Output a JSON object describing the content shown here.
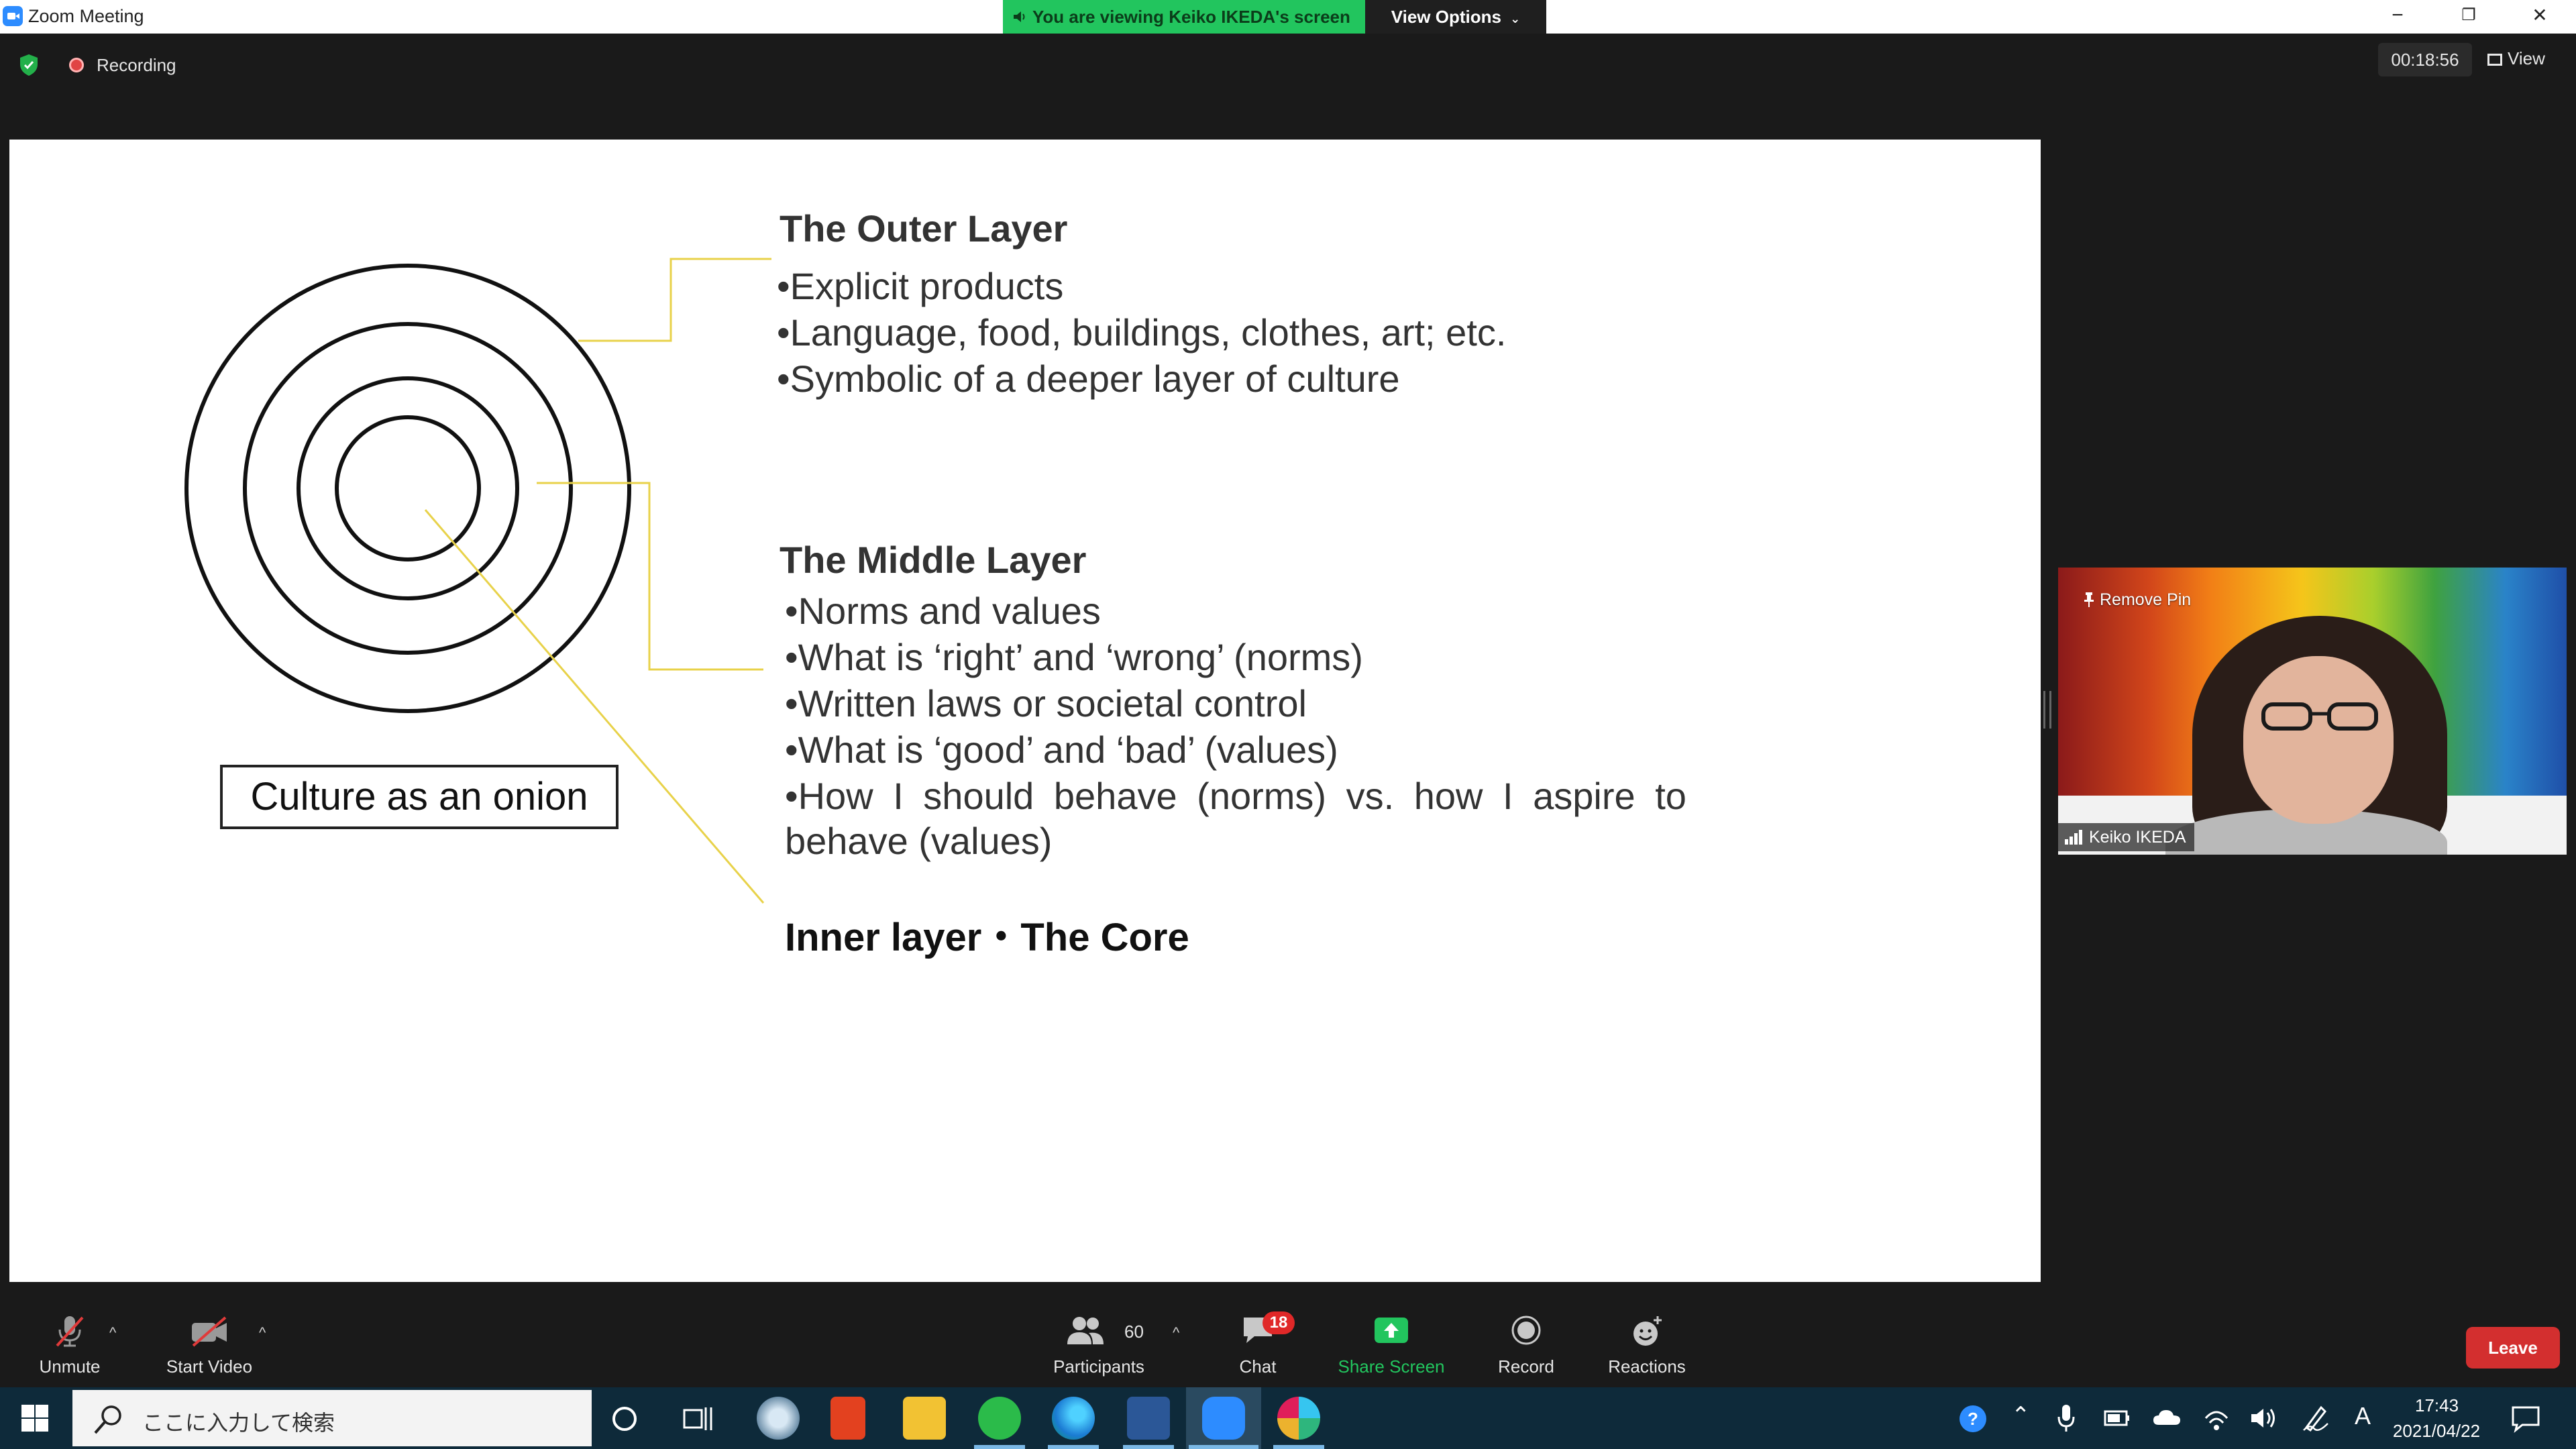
{
  "window": {
    "title": "Zoom Meeting",
    "banner": "You are viewing Keiko IKEDA's screen",
    "view_options": "View Options",
    "minimize": "−",
    "restore": "❐",
    "close": "✕"
  },
  "status": {
    "recording": "Recording",
    "timer": "00:18:56",
    "view": "View"
  },
  "slide": {
    "outer_heading": "The Outer Layer",
    "outer_bullets": [
      "•Explicit products",
      "•Language, food, buildings, clothes, art; etc.",
      "•Symbolic of a deeper layer of culture"
    ],
    "middle_heading": "The Middle Layer",
    "middle_bullets": [
      "•Norms and values",
      "•What is ‘right’ and ‘wrong’ (norms)",
      "•Written laws or societal control",
      "•What is ‘good’ and ‘bad’ (values)",
      "•How I should behave (norms) vs. how I aspire to",
      "behave (values)"
    ],
    "inner_heading": "Inner layer・The Core",
    "caption": "Culture as an onion"
  },
  "video": {
    "remove_pin": "Remove Pin",
    "participant_name": "Keiko IKEDA"
  },
  "toolbar": {
    "unmute": "Unmute",
    "start_video": "Start Video",
    "participants": "Participants",
    "participant_count": "60",
    "chat": "Chat",
    "chat_badge": "18",
    "share_screen": "Share Screen",
    "record": "Record",
    "reactions": "Reactions",
    "leave": "Leave",
    "caret": "^"
  },
  "taskbar": {
    "search_placeholder": "ここに入力して検索",
    "time": "17:43",
    "date": "2021/04/22",
    "ime": "A"
  },
  "colors": {
    "zoom_blue": "#2d8cff",
    "banner_green": "#22c55e",
    "leave_red": "#d32f2f",
    "badge_red": "#e02828",
    "leader_line": "#e8d24a"
  }
}
